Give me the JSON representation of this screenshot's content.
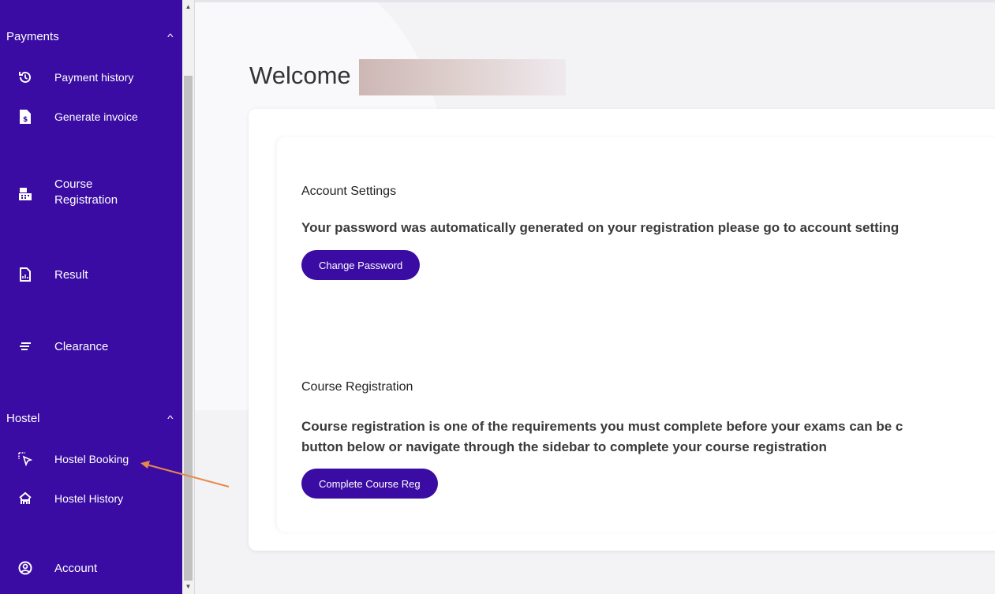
{
  "sidebar": {
    "payments_section": "Payments",
    "payment_history": "Payment history",
    "generate_invoice": "Generate invoice",
    "course_registration": "Course Registration",
    "result": "Result",
    "clearance": "Clearance",
    "hostel_section": "Hostel",
    "hostel_booking": "Hostel Booking",
    "hostel_history": "Hostel History",
    "account": "Account"
  },
  "main": {
    "welcome": "Welcome",
    "account_settings_title": "Account Settings",
    "account_settings_text": "Your password was automatically generated on your registration please go to account setting",
    "change_password_button": "Change Password",
    "course_reg_title": "Course Registration",
    "course_reg_text_line1": "Course registration is one of the requirements you must complete before your exams can be c",
    "course_reg_text_line2": "button below or navigate through the sidebar to complete your course registration",
    "complete_course_reg_button": "Complete Course Reg"
  },
  "colors": {
    "sidebar_bg": "#3a0ca3",
    "button_bg": "#3a0ca3",
    "annotation_arrow": "#e8894a"
  },
  "icons": [
    "history-icon",
    "invoice-icon",
    "register-icon",
    "result-icon",
    "clearance-icon",
    "chevron-up-icon",
    "hostel-booking-icon",
    "hostel-history-icon",
    "account-icon"
  ]
}
